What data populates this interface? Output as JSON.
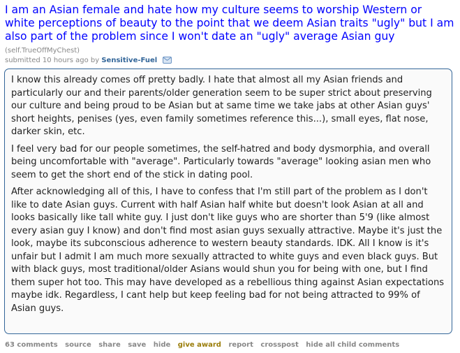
{
  "post": {
    "title": "I am an Asian female and hate how my culture seems to worship Western or white perceptions of beauty to the point that we deem Asian traits \"ugly\" but I am also part of the problem since I won't date an \"ugly\" average Asian guy",
    "domain": "(self.TrueOffMyChest)",
    "tagline": {
      "prefix": "submitted 10 hours ago by",
      "author": "Sensitive-Fuel"
    },
    "paragraphs": [
      "I know this already comes off pretty badly. I hate that almost all my Asian friends and particularly our and their parents/older generation seem to be super strict about preserving our culture and being proud to be Asian but at same time we take jabs at other Asian guys' short heights, penises (yes, even family sometimes reference this...), small eyes, flat nose, darker skin, etc.",
      "I feel very bad for our people sometimes, the self-hatred and body dysmorphia, and overall being uncomfortable with \"average\". Particularly towards \"average\" looking asian men who seem to get the short end of the stick in dating pool.",
      "After acknowledging all of this, I have to confess that I'm still part of the problem as I don't like to date Asian guys. Current with half Asian half white but doesn't look Asian at all and looks basically like tall white guy. I just don't like guys who are shorter than 5'9 (like almost every asian guy I know) and don't find most asian guys sexually attractive. Maybe it's just the look, maybe its subconscious adherence to western beauty standards. IDK. All I know is it's unfair but I admit I am much more sexually attracted to white guys and even black guys. But with black guys, most traditional/older Asians would shun you for being with one, but I find them super hot too. This may have developed as a rebellious thing against Asian expectations maybe idk. Regardless, I cant help but keep feeling bad for not being attracted to 99% of Asian guys."
    ],
    "buttons": {
      "comments": "63 comments",
      "source": "source",
      "share": "share",
      "save": "save",
      "hide": "hide",
      "give_award": "give award",
      "report": "report",
      "crosspost": "crosspost",
      "hide_child": "hide all child comments"
    }
  },
  "colors": {
    "title_link": "#0000ff",
    "author": "#336699",
    "selftext_border": "#336699",
    "award": "#9a7d0a"
  },
  "icons": {
    "author_flair": "message-envelope-icon"
  }
}
